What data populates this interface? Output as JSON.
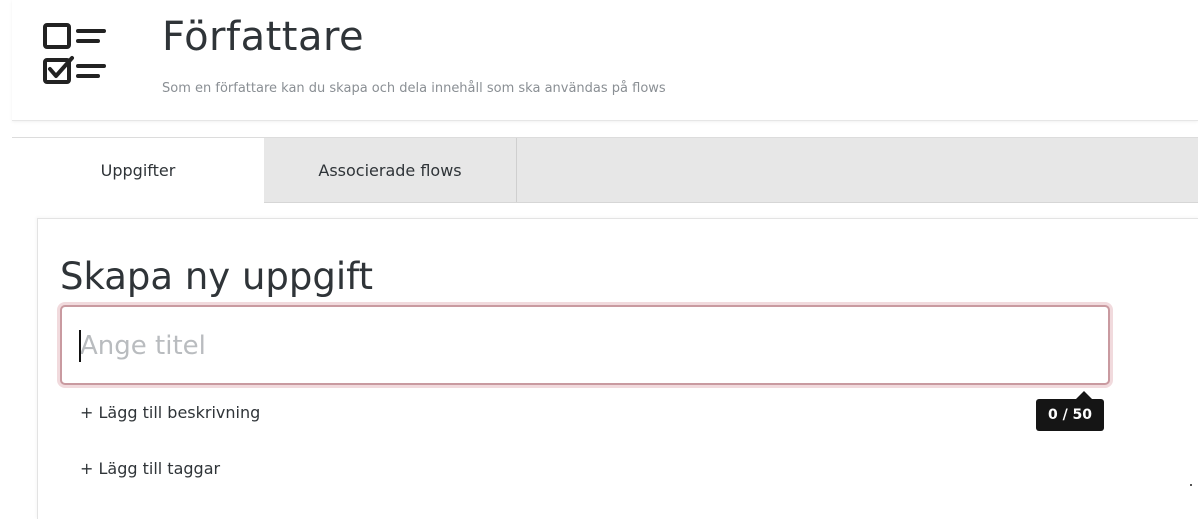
{
  "header": {
    "icon": "checklist-icon",
    "title": "Författare",
    "subtitle": "Som en författare kan du skapa och dela innehåll som ska användas på flows"
  },
  "tabs": [
    {
      "label": "Uppgifter",
      "active": true
    },
    {
      "label": "Associerade flows",
      "active": false
    }
  ],
  "form": {
    "section_title": "Skapa ny uppgift",
    "title_input": {
      "value": "",
      "placeholder": "Ange titel"
    },
    "counter": "0 / 50",
    "add_description": "+ Lägg till beskrivning",
    "add_tags": "+ Lägg till taggar"
  },
  "colors": {
    "input_border": "#c99aa0",
    "counter_bg": "#151515",
    "tabbar_bg": "#e7e7e7"
  }
}
